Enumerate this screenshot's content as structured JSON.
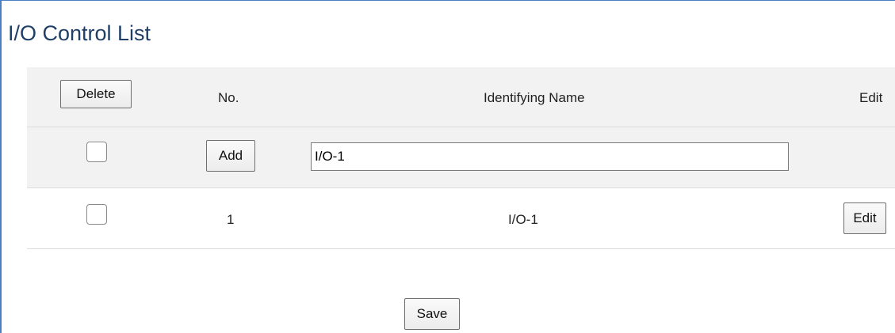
{
  "title": "I/O Control List",
  "header": {
    "delete_label": "Delete",
    "col_no": "No.",
    "col_name": "Identifying Name",
    "col_edit": "Edit"
  },
  "add_row": {
    "add_label": "Add",
    "name_value": "I/O-1",
    "checked": false
  },
  "rows": [
    {
      "no": "1",
      "name": "I/O-1",
      "edit_label": "Edit",
      "checked": false
    }
  ],
  "footer": {
    "save_label": "Save"
  },
  "colors": {
    "frame_border": "#4a7fc1",
    "title_text": "#1f3f67",
    "row_background": "#f2f2f2"
  }
}
